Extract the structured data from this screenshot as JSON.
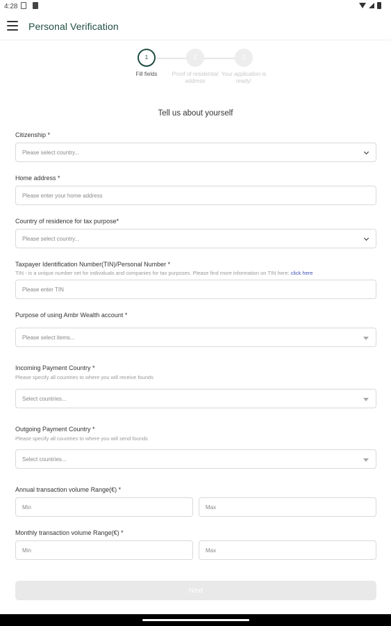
{
  "status_bar": {
    "time": "4:28"
  },
  "app_bar": {
    "title": "Personal Verification"
  },
  "stepper": {
    "steps": [
      {
        "number": "1",
        "label": "Fill fields"
      },
      {
        "number": "2",
        "label": "Proof of residential address"
      },
      {
        "number": "3",
        "label": "Your application is ready!"
      }
    ]
  },
  "form": {
    "title": "Tell us about yourself",
    "citizenship": {
      "label": "Citizenship *",
      "placeholder": "Please select country..."
    },
    "home_address": {
      "label": "Home address *",
      "placeholder": "Please enter your home address"
    },
    "tax_country": {
      "label": "Country of residence for tax purpose*",
      "placeholder": "Please select country..."
    },
    "tin": {
      "label": "Taxpayer Identification Number(TIN)/Personal Number *",
      "hint": "TIN - is a unique number set for individuals and companies for tax purposes. Please find more information on TIN here:",
      "hint_link": "click here",
      "placeholder": "Please enter TIN"
    },
    "purpose": {
      "label": "Purpose of using Ambr Wealth account *",
      "placeholder": "Please select items..."
    },
    "incoming": {
      "label": "Incoming Payment Country *",
      "hint": "Please specify all countries to where you will receive founds",
      "placeholder": "Select countries..."
    },
    "outgoing": {
      "label": "Outgoing Payment Country *",
      "hint": "Please specify all countries to where you will send founds",
      "placeholder": "Select countries..."
    },
    "annual": {
      "label": "Annual transaction volume Range(€) *",
      "min_placeholder": "Min",
      "max_placeholder": "Max"
    },
    "monthly": {
      "label": "Monthly transaction volume Range(€) *",
      "min_placeholder": "Min",
      "max_placeholder": "Max"
    },
    "next_label": "Next"
  }
}
